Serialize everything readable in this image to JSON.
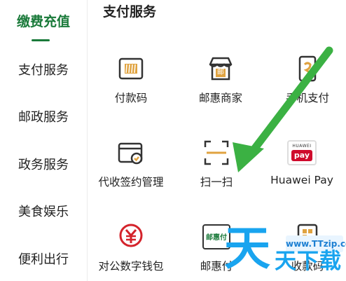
{
  "sidebar": {
    "items": [
      {
        "label": "缴费充值",
        "active": true
      },
      {
        "label": "支付服务",
        "active": false
      },
      {
        "label": "邮政服务",
        "active": false
      },
      {
        "label": "政务服务",
        "active": false
      },
      {
        "label": "美食娱乐",
        "active": false
      },
      {
        "label": "便利出行",
        "active": false
      }
    ]
  },
  "main": {
    "section_title": "支付服务",
    "tiles": [
      {
        "label": "付款码",
        "icon": "payment-code-icon"
      },
      {
        "label": "邮惠商家",
        "icon": "merchant-store-icon"
      },
      {
        "label": "手机支付",
        "icon": "phone-pay-icon"
      },
      {
        "label": "代收签约管理",
        "icon": "collection-contract-icon"
      },
      {
        "label": "扫一扫",
        "icon": "scan-icon"
      },
      {
        "label": "Huawei Pay",
        "icon": "huawei-pay-icon",
        "icon_text": "HUAWEI",
        "icon_sub": "pay"
      },
      {
        "label": "对公数字钱包",
        "icon": "digital-yuan-wallet-icon"
      },
      {
        "label": "邮惠付",
        "icon": "youhuifu-icon",
        "icon_text": "邮惠付"
      },
      {
        "label": "收款码",
        "icon": "receive-code-icon"
      }
    ]
  },
  "icon_texts": {
    "merchant": "邮"
  },
  "watermark": {
    "url": "www.TTzip.com",
    "big": "天",
    "small": "天下载"
  },
  "colors": {
    "accent_green": "#1a7a3a",
    "arrow_green": "#3bb143",
    "huawei_red": "#cf0a2c",
    "yuan_red": "#d4232b",
    "watermark_blue": "#19a4ef"
  }
}
